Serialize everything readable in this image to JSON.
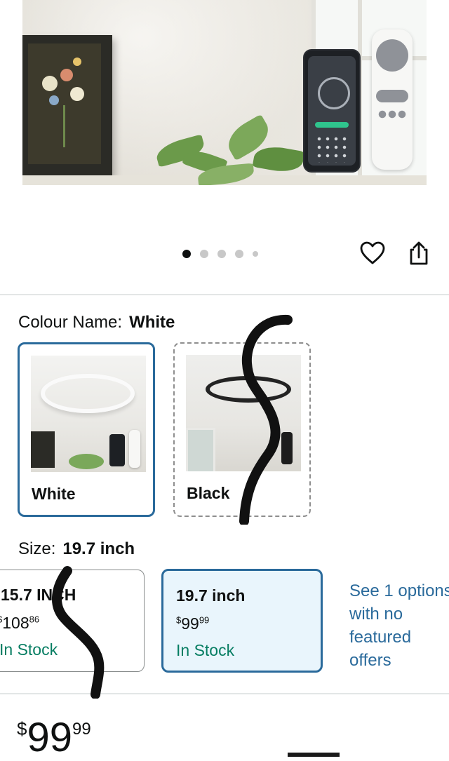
{
  "carousel": {
    "total_images": 5,
    "active_index": 0
  },
  "actions": {
    "favorite_icon": "heart-icon",
    "share_icon": "share-icon"
  },
  "colour": {
    "label": "Colour Name:",
    "selected": "White",
    "options": [
      {
        "name": "White",
        "selected": true
      },
      {
        "name": "Black",
        "selected": false
      }
    ]
  },
  "size": {
    "label": "Size:",
    "selected": "19.7 inch",
    "options": [
      {
        "title": "15.7 INCH",
        "price_symbol": "$",
        "price_whole": "108",
        "price_cents": "86",
        "stock": "In Stock",
        "selected": false
      },
      {
        "title": "19.7 inch",
        "price_symbol": "$",
        "price_whole": "99",
        "price_cents": "99",
        "stock": "In Stock",
        "selected": true
      }
    ],
    "see_options": "See 1 options with no featured offers"
  },
  "price": {
    "symbol": "$",
    "whole": "99",
    "cents": "99"
  },
  "colors": {
    "accent": "#2a6a9b",
    "stock_green": "#067d62",
    "selected_bg": "#e9f5fc"
  }
}
